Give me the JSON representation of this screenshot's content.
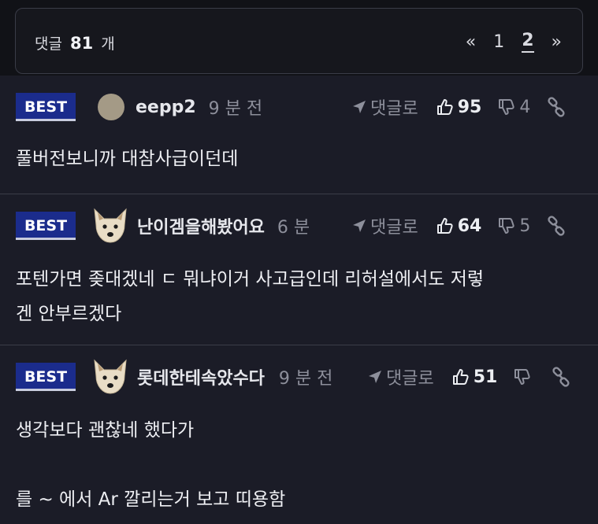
{
  "header": {
    "count_prefix": "댓글",
    "count": "81",
    "count_suffix": "개",
    "pager": {
      "prev": "«",
      "pages": [
        "1",
        "2"
      ],
      "next": "»"
    }
  },
  "comments": [
    {
      "badge": "BEST",
      "nick": "eepp2",
      "time": "9 분 전",
      "reply_label": "댓글로",
      "likes": "95",
      "dislikes": "4",
      "lines": [
        "풀버전보니까 대참사급이던데"
      ]
    },
    {
      "badge": "BEST",
      "nick": "난이겜을해봤어요",
      "time": "6 분",
      "reply_label": "댓글로",
      "likes": "64",
      "dislikes": "5",
      "lines": [
        "포텐가면 좆대겠네 ㄷ 뭐냐이거 사고급인데 리허설에서도 저렇",
        "겐 안부르겠다"
      ]
    },
    {
      "badge": "BEST",
      "nick": "롯데한테속았수다",
      "time": "9 분 전",
      "reply_label": "댓글로",
      "likes": "51",
      "dislikes": "",
      "lines": [
        "생각보다 괜찮네 했다가",
        "",
        "를 ~ 에서 Ar 깔리는거 보고 띠용함"
      ]
    }
  ],
  "colors": {
    "background": "#1b1c27",
    "best_badge": "#1b2c8c",
    "divider": "#3b3d48",
    "muted_text": "#8d8f9b"
  }
}
